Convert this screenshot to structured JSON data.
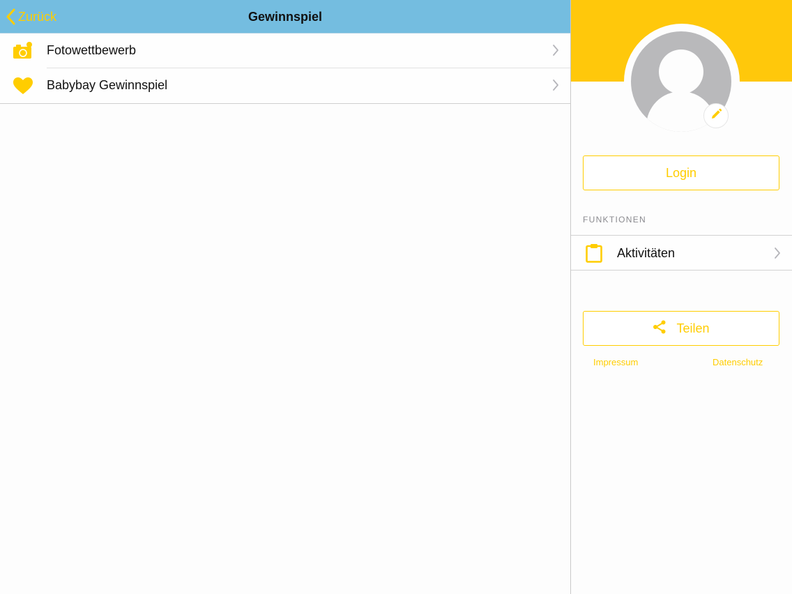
{
  "colors": {
    "accent": "#ffcd00",
    "navbar": "#74bde0",
    "banner": "#ffc80b",
    "avatar": "#b9b9bb"
  },
  "navbar": {
    "back_label": "Zurück",
    "title": "Gewinnspiel"
  },
  "list": {
    "items": [
      {
        "label": "Fotowettbewerb",
        "icon": "camera-icon"
      },
      {
        "label": "Babybay Gewinnspiel",
        "icon": "heart-icon"
      }
    ]
  },
  "profile": {
    "avatar_icon": "user-silhouette-icon",
    "edit_icon": "pencil-icon",
    "login_label": "Login"
  },
  "functions": {
    "heading": "FUNKTIONEN",
    "items": [
      {
        "label": "Aktivitäten",
        "icon": "clipboard-icon"
      }
    ]
  },
  "share": {
    "label": "Teilen",
    "icon": "share-icon"
  },
  "footer": {
    "impressum": "Impressum",
    "datenschutz": "Datenschutz"
  }
}
